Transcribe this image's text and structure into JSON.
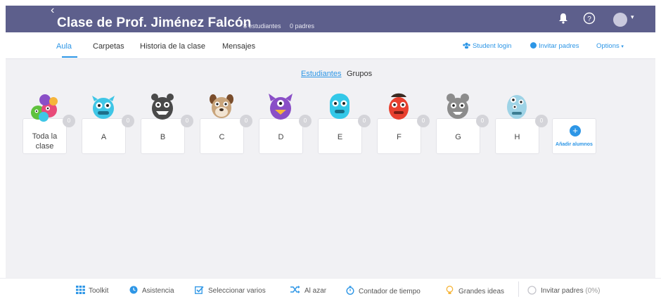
{
  "header": {
    "title": "Clase de Prof. Jiménez Falcón",
    "students_count": "8 estudiantes",
    "parents_count": "0 padres"
  },
  "nav": {
    "tabs": [
      {
        "label": "Aula",
        "active": true
      },
      {
        "label": "Carpetas"
      },
      {
        "label": "Historia de la clase"
      },
      {
        "label": "Mensajes"
      }
    ],
    "student_login": "Student login",
    "invite_parents": "Invitar padres",
    "options": "Options"
  },
  "view_toggle": {
    "students": "Estudiantes",
    "groups": "Grupos"
  },
  "cards": [
    {
      "name": "Toda la clase",
      "points": "0",
      "color": "#e84b7a"
    },
    {
      "name": "A",
      "points": "0",
      "color": "#3fc6e6"
    },
    {
      "name": "B",
      "points": "0",
      "color": "#4a4a4a"
    },
    {
      "name": "C",
      "points": "0",
      "color": "#c9a57c"
    },
    {
      "name": "D",
      "points": "0",
      "color": "#8a4fc7"
    },
    {
      "name": "E",
      "points": "0",
      "color": "#33c8e8"
    },
    {
      "name": "F",
      "points": "0",
      "color": "#e8402f"
    },
    {
      "name": "G",
      "points": "0",
      "color": "#8c8c8c"
    },
    {
      "name": "H",
      "points": "0",
      "color": "#9ed3e6"
    }
  ],
  "add_students": "Añadir alumnos",
  "footer": {
    "toolkit": "Toolkit",
    "attendance": "Asistencia",
    "select_multiple": "Seleccionar varios",
    "random": "Al azar",
    "timer": "Contador de tiempo",
    "big_ideas": "Grandes ideas",
    "invite_parents": "Invitar padres",
    "invite_percent": "(0%)"
  },
  "colors": {
    "header_bg": "#5d5f8c",
    "accent": "#2d96e6",
    "main_bg": "#f1f1f4"
  }
}
